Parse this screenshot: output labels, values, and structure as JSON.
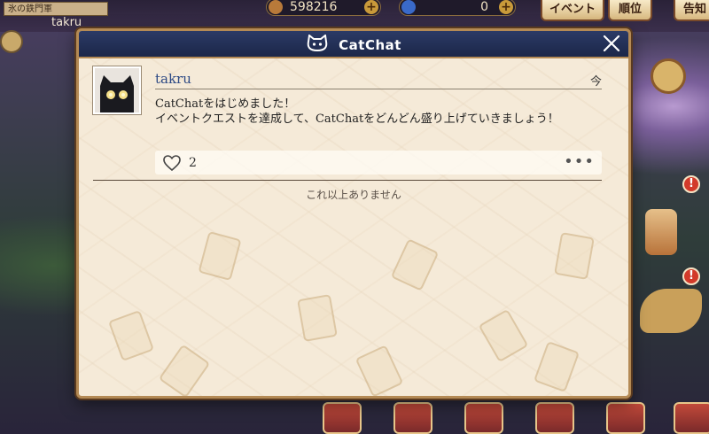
{
  "hud": {
    "top_left_label": "氷の鉄門軍",
    "user_name": "takru",
    "currency_1": "598216",
    "currency_2": "0",
    "event_button": "イベント",
    "rank_button": "順位",
    "notice_button": "告知",
    "alert_symbol": "!"
  },
  "modal": {
    "title": "CatChat",
    "close_icon": "close-icon",
    "post": {
      "user": "takru",
      "time": "今",
      "body_line1": "CatChatをはじめました！",
      "body_line2": "イベントクエストを達成して、CatChatをどんどん盛り上げていきましょう！",
      "like_count": "2",
      "more": "•••"
    },
    "end_message": "これ以上ありません"
  },
  "colors": {
    "header": "#1c2749",
    "panel": "#f5ead8",
    "border": "#b48a55",
    "username": "#2d4a85"
  }
}
